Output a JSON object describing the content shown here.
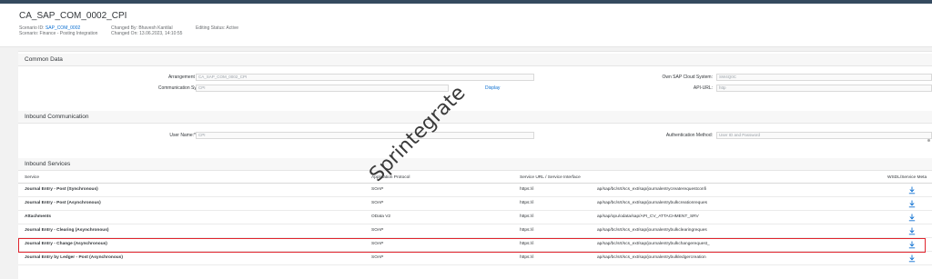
{
  "header": {
    "title": "CA_SAP_COM_0002_CPI",
    "scenario_id_label": "Scenario ID:",
    "scenario_id_value": "SAP_COM_0002",
    "scenario_label": "Scenario:",
    "scenario_value": "Finance - Posting Integration",
    "changed_by_label": "Changed By:",
    "changed_by_value": "Bhavesh Kantilal",
    "changed_on_label": "Changed On:",
    "changed_on_value": "13.06.2023, 14:10:55",
    "editing_status_label": "Editing Status:",
    "editing_status_value": "Active"
  },
  "common_data": {
    "section_title": "Common Data",
    "arrangement_name_label": "Arrangement Name:",
    "arrangement_name_value": "CA_SAP_COM_0002_CPI",
    "communication_system_label": "Communication System:*",
    "communication_system_value": "CPI",
    "display_link": "Display",
    "own_system_label": "Own SAP Cloud System:",
    "own_system_value": "SW4Q0C",
    "api_url_label": "API-URL:",
    "api_url_value": "http"
  },
  "inbound_communication": {
    "section_title": "Inbound Communication",
    "user_name_label": "User Name:*",
    "user_name_value": "CPI",
    "auth_method_label": "Authentication Method:",
    "auth_method_value": "User ID and Password"
  },
  "inbound_services": {
    "section_title": "Inbound Services",
    "columns": {
      "service": "Service",
      "protocol": "Application Protocol",
      "url": "Service URL / Service Interface",
      "wsdl": "WSDL/Service Meta"
    },
    "rows": [
      {
        "service": "Journal Entry - Post (Synchronous)",
        "protocol": "SOAP",
        "url": "https://i",
        "iface": "ap/sap/bc/srt/scs_ext/sap/journalentrycreaterequestconfi"
      },
      {
        "service": "Journal Entry - Post (Asynchronous)",
        "protocol": "SOAP",
        "url": "https://i",
        "iface": "ap/sap/bc/srt/scs_ext/sap/journalentrybulkcreationreques"
      },
      {
        "service": "Attachments",
        "protocol": "OData V2",
        "url": "https://i",
        "iface": "ap/sap/opu/odata/sap/API_CV_ATTACHMENT_SRV"
      },
      {
        "service": "Journal Entry - Clearing (Asynchronous)",
        "protocol": "SOAP",
        "url": "https://i",
        "iface": "ap/sap/bc/srt/scs_ext/sap/journalentrybulkclearingreques"
      },
      {
        "service": "Journal Entry - Change (Asynchronous)",
        "protocol": "SOAP",
        "url": "https://i",
        "iface": "ap/sap/bc/srt/scs_ext/sap/journalentrybulkchangerequest_"
      },
      {
        "service": "Journal Entry by Ledger - Post (Asynchronous)",
        "protocol": "SOAP",
        "url": "https://i",
        "iface": "ap/sap/bc/srt/scs_ext/sap/journalentrybulkledgercreation"
      }
    ]
  },
  "watermark": "Sprintegrate",
  "colors": {
    "link": "#0a6ed1",
    "highlight_border": "#e0242d",
    "shell_bar": "#354a5f"
  },
  "icons": {
    "download": "download-icon"
  }
}
